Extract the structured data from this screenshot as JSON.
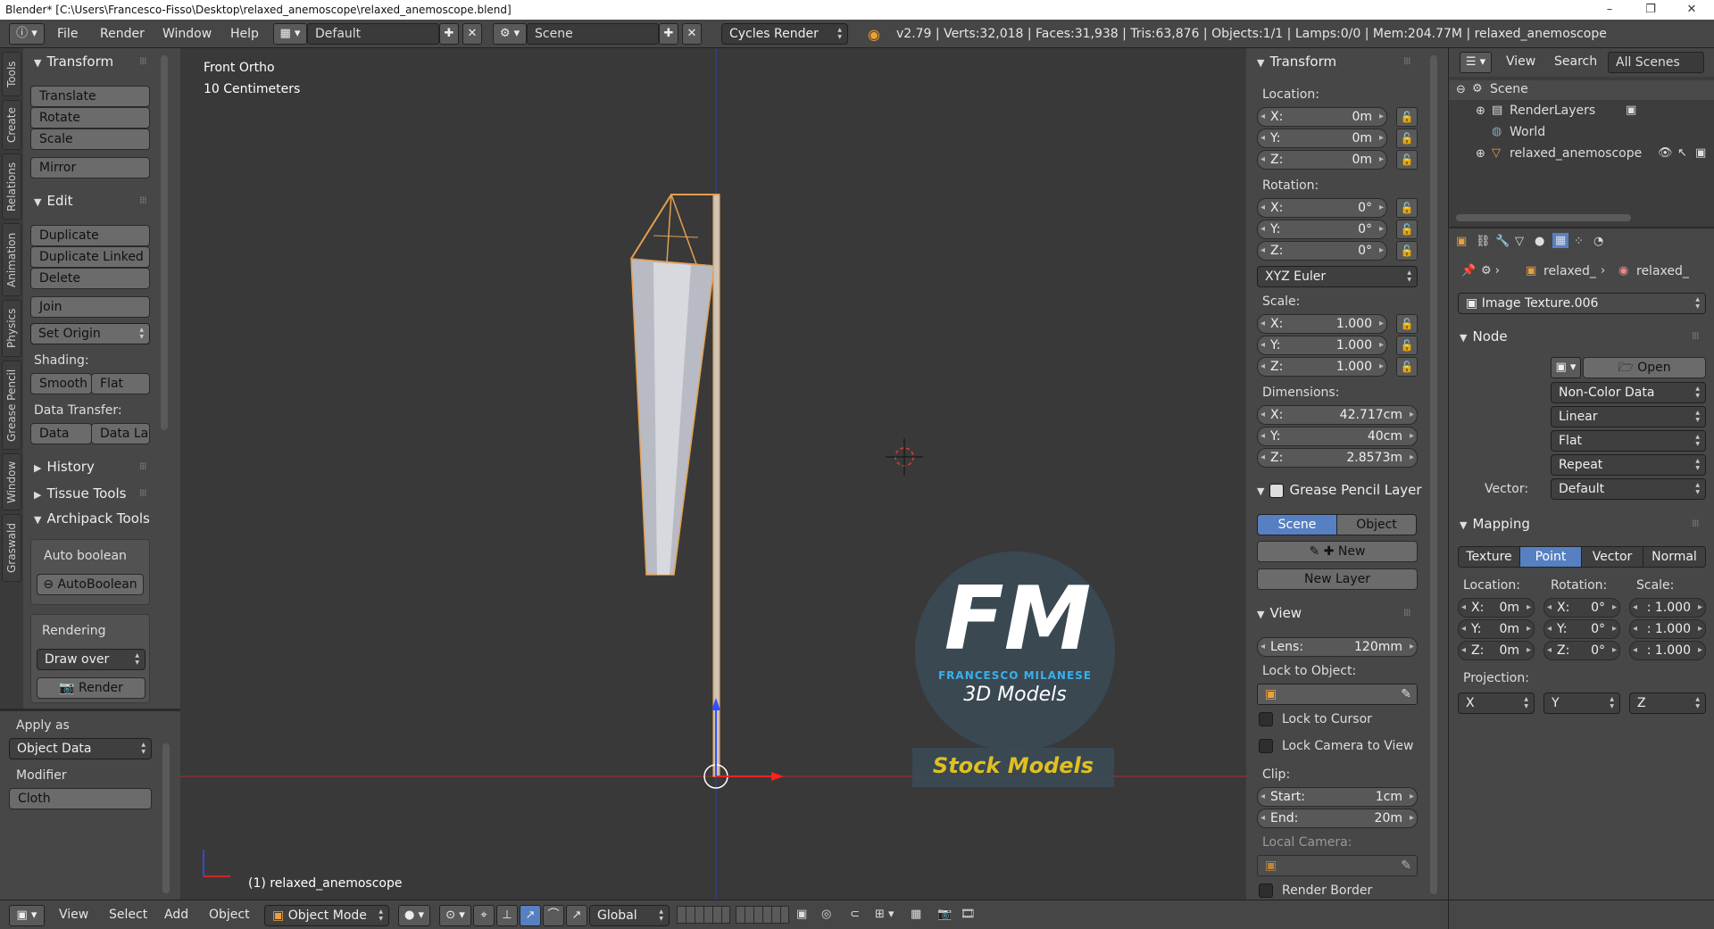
{
  "titlebar": {
    "text": "Blender* [C:\\Users\\Francesco-Fisso\\Desktop\\relaxed_anemoscope\\relaxed_anemoscope.blend]",
    "minimize": "–",
    "maximize": "❐",
    "close": "✕"
  },
  "topbar": {
    "menus": [
      "File",
      "Render",
      "Window",
      "Help"
    ],
    "layout": "Default",
    "scene": "Scene",
    "engine": "Cycles Render",
    "stats": "v2.79 | Verts:32,018 | Faces:31,938 | Tris:63,876 | Objects:1/1 | Lamps:0/0 | Mem:204.77M | relaxed_anemoscope"
  },
  "tool_tabs": [
    "Tools",
    "Create",
    "Relations",
    "Animation",
    "Physics",
    "Grease Pencil",
    "Window",
    "Graswald"
  ],
  "tools": {
    "transform_header": "Transform",
    "translate": "Translate",
    "rotate": "Rotate",
    "scale": "Scale",
    "mirror": "Mirror",
    "edit_header": "Edit",
    "duplicate": "Duplicate",
    "duplicate_linked": "Duplicate Linked",
    "delete": "Delete",
    "join": "Join",
    "set_origin": "Set Origin",
    "shading_label": "Shading:",
    "smooth": "Smooth",
    "flat": "Flat",
    "data_transfer_label": "Data Transfer:",
    "data": "Data",
    "data_la": "Data La",
    "history": "History",
    "tissue": "Tissue Tools",
    "archipack": "Archipack Tools",
    "auto_boolean_label": "Auto boolean",
    "auto_boolean_btn": "AutoBoolean",
    "rendering_label": "Rendering",
    "draw_over": "Draw over",
    "render_btn": "Render"
  },
  "operator": {
    "apply_as_label": "Apply as",
    "apply_as_value": "Object Data",
    "modifier_label": "Modifier",
    "modifier_value": "Cloth"
  },
  "viewport": {
    "view_name": "Front Ortho",
    "scale_text": "10 Centimeters",
    "object_label": "(1) relaxed_anemoscope",
    "watermark_letters": "FM",
    "watermark_name": "FRANCESCO MILANESE",
    "watermark_sub": "3D Models",
    "watermark_stock": "Stock Models"
  },
  "properties": {
    "transform_header": "Transform",
    "location_label": "Location:",
    "loc": [
      {
        "k": "X:",
        "v": "0m"
      },
      {
        "k": "Y:",
        "v": "0m"
      },
      {
        "k": "Z:",
        "v": "0m"
      }
    ],
    "rotation_label": "Rotation:",
    "rot": [
      {
        "k": "X:",
        "v": "0°"
      },
      {
        "k": "Y:",
        "v": "0°"
      },
      {
        "k": "Z:",
        "v": "0°"
      }
    ],
    "rotation_mode": "XYZ Euler",
    "scale_label": "Scale:",
    "scl": [
      {
        "k": "X:",
        "v": "1.000"
      },
      {
        "k": "Y:",
        "v": "1.000"
      },
      {
        "k": "Z:",
        "v": "1.000"
      }
    ],
    "dimensions_label": "Dimensions:",
    "dim": [
      {
        "k": "X:",
        "v": "42.717cm"
      },
      {
        "k": "Y:",
        "v": "40cm"
      },
      {
        "k": "Z:",
        "v": "2.8573m"
      }
    ],
    "grease_header": "Grease Pencil Layer",
    "gp_scene": "Scene",
    "gp_object": "Object",
    "gp_new": "New",
    "gp_new_layer": "New Layer",
    "view_header": "View",
    "lens_label": "Lens:",
    "lens_value": "120mm",
    "lock_object_label": "Lock to Object:",
    "lock_cursor": "Lock to Cursor",
    "lock_camera": "Lock Camera to View",
    "clip_label": "Clip:",
    "clip_start_label": "Start:",
    "clip_start": "1cm",
    "clip_end_label": "End:",
    "clip_end": "20m",
    "local_camera_label": "Local Camera:",
    "render_border": "Render Border"
  },
  "outliner": {
    "view": "View",
    "search": "Search",
    "filter": "All Scenes",
    "items": [
      "Scene",
      "RenderLayers",
      "World",
      "relaxed_anemoscope"
    ]
  },
  "node_props": {
    "crumb1": "relaxed_",
    "crumb2": "relaxed_",
    "image_texture": "Image Texture.006",
    "node_header": "Node",
    "open": "Open",
    "color_space": "Non-Color Data",
    "interp": "Linear",
    "projection_mode": "Flat",
    "extension": "Repeat",
    "vector_label": "Vector:",
    "vector_value": "Default",
    "mapping_header": "Mapping",
    "tabs": [
      "Texture",
      "Point",
      "Vector",
      "Normal"
    ],
    "loc_label": "Location:",
    "rot_label": "Rotation:",
    "scale_label": "Scale:",
    "loc": [
      {
        "k": "X:",
        "v": "0m"
      },
      {
        "k": "Y:",
        "v": "0m"
      },
      {
        "k": "Z:",
        "v": "0m"
      }
    ],
    "rot": [
      {
        "k": "X:",
        "v": "0°"
      },
      {
        "k": "Y:",
        "v": "0°"
      },
      {
        "k": "Z:",
        "v": "0°"
      }
    ],
    "scl": [
      ": 1.000",
      ": 1.000",
      ": 1.000"
    ],
    "projection_label": "Projection:",
    "proj": [
      "X",
      "Y",
      "Z"
    ]
  },
  "bottombar": {
    "menus": [
      "View",
      "Select",
      "Add",
      "Object"
    ],
    "mode": "Object Mode",
    "orientation": "Global"
  }
}
